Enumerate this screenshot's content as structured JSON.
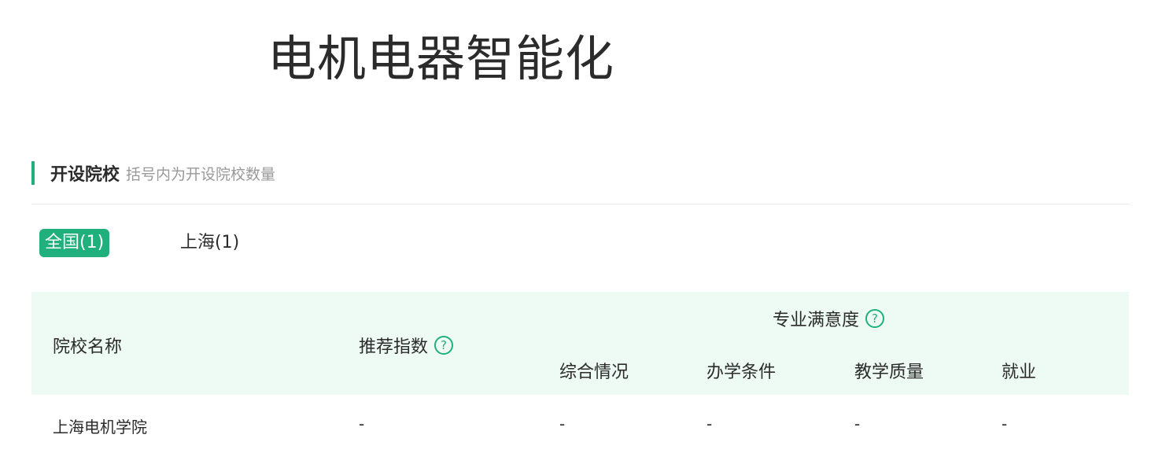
{
  "page": {
    "title": "电机电器智能化"
  },
  "section": {
    "title": "开设院校",
    "subtitle": "括号内为开设院校数量"
  },
  "tabs": [
    {
      "label": "全国(1)",
      "active": true
    },
    {
      "label": "上海(1)",
      "active": false
    }
  ],
  "table": {
    "headers": {
      "school_name": "院校名称",
      "recommend_index": "推荐指数",
      "satisfaction": "专业满意度",
      "overall": "综合情况",
      "conditions": "办学条件",
      "quality": "教学质量",
      "employment": "就业"
    },
    "help_icon_glyph": "?",
    "rows": [
      {
        "school_name": "上海电机学院",
        "recommend_index": "-",
        "overall": "-",
        "conditions": "-",
        "quality": "-",
        "employment": "-"
      }
    ]
  },
  "colors": {
    "accent": "#1fb07c",
    "header_bg": "#eefbf5",
    "text": "#2b2b2b",
    "muted": "#999999"
  },
  "icons": {
    "help": "question-circle-icon"
  }
}
